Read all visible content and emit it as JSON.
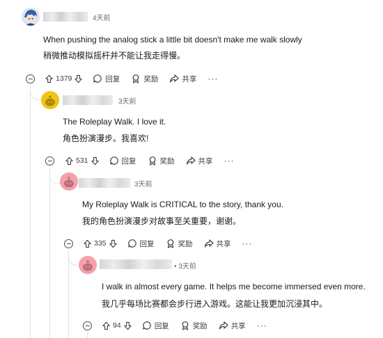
{
  "comments": [
    {
      "time": "4天前",
      "en": "When pushing the analog stick a little bit doesn't make me walk slowly",
      "zh": "稍微推动模拟摇杆并不能让我走得慢。",
      "votes": "1379"
    },
    {
      "time": "3天前",
      "en": "The Roleplay Walk. I love it.",
      "zh": "角色扮演漫步。我喜欢!",
      "votes": "531"
    },
    {
      "time": "3天前",
      "en": "My Roleplay Walk is CRITICAL to the story, thank you.",
      "zh": "我的角色扮演漫步对故事至关重要，谢谢。",
      "votes": "335"
    },
    {
      "time": "• 3天前",
      "en": "I walk in almost every game. It helps me become immersed even more.",
      "zh": "我几乎每场比赛都会步行进入游戏。这能让我更加沉浸其中。",
      "votes": "94"
    }
  ],
  "actions": {
    "reply": "回复",
    "award": "奖励",
    "share": "共享",
    "more": "···"
  },
  "icons": [
    "upvote-icon",
    "downvote-icon",
    "reply-icon",
    "award-icon",
    "share-icon",
    "collapse-icon"
  ]
}
